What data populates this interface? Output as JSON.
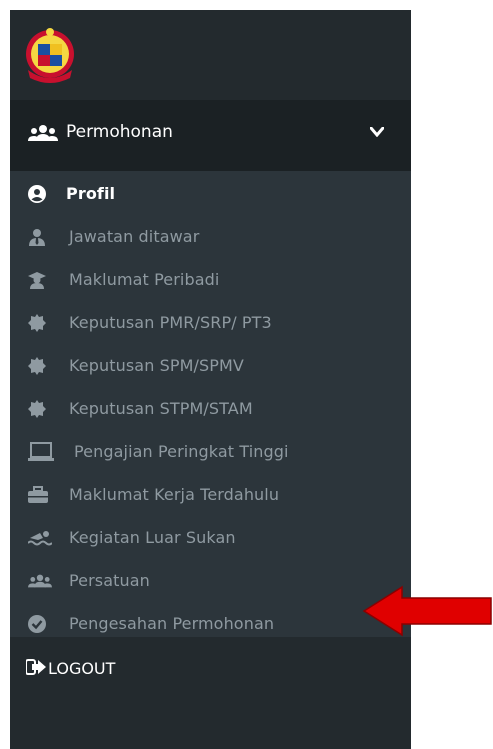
{
  "sidebar": {
    "logo_icon": "crest-logo",
    "header": {
      "label": "Permohonan",
      "icon": "users-icon",
      "toggle_icon": "chevron-down-icon"
    },
    "items": [
      {
        "label": "Profil",
        "icon": "user-circle-icon",
        "active": true
      },
      {
        "label": "Jawatan ditawar",
        "icon": "user-tie-icon"
      },
      {
        "label": "Maklumat Peribadi",
        "icon": "graduate-icon"
      },
      {
        "label": "Keputusan PMR/SRP/ PT3",
        "icon": "certificate-icon"
      },
      {
        "label": "Keputusan SPM/SPMV",
        "icon": "certificate-icon"
      },
      {
        "label": "Keputusan STPM/STAM",
        "icon": "certificate-icon"
      },
      {
        "label": "Pengajian Peringkat Tinggi",
        "icon": "laptop-icon"
      },
      {
        "label": "Maklumat Kerja Terdahulu",
        "icon": "briefcase-icon"
      },
      {
        "label": "Kegiatan Luar Sukan",
        "icon": "swimmer-icon"
      },
      {
        "label": "Persatuan",
        "icon": "users-icon"
      },
      {
        "label": "Pengesahan Permohonan",
        "icon": "check-circle-icon"
      }
    ],
    "logout": {
      "label": "LOGOUT",
      "icon": "sign-out-icon"
    }
  },
  "annotation": {
    "type": "arrow",
    "color": "#e00000",
    "points_to": "Pengesahan Permohonan"
  },
  "colors": {
    "sidebar_bg": "#232a2e",
    "submenu_bg": "#2c353b",
    "header_bg": "#1b2124",
    "muted_text": "#8f9aa1",
    "active_text": "#ffffff"
  }
}
